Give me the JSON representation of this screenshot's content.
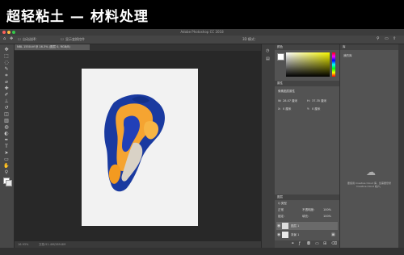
{
  "banner": {
    "title": "超轻粘土 — 材料处理"
  },
  "window": {
    "title": "Adobe Photoshop CC 2018"
  },
  "options_bar": {
    "auto_select_label": "自动选择：",
    "transform_label": "显示变换控件",
    "mode_label": "3D 模式："
  },
  "document": {
    "tab_label": "NBL 1550.tif @ 16.3% (图层 0, RGB/8)",
    "zoom": "16.93%",
    "doc_size": "文档:51.4M/289.8M"
  },
  "tools": [
    {
      "icon": "move-tool-icon",
      "glyph": "✥"
    },
    {
      "icon": "marquee-tool-icon",
      "glyph": "⬚"
    },
    {
      "icon": "lasso-tool-icon",
      "glyph": "◌"
    },
    {
      "icon": "quick-select-tool-icon",
      "glyph": "✎"
    },
    {
      "icon": "crop-tool-icon",
      "glyph": "⌗"
    },
    {
      "icon": "eyedropper-tool-icon",
      "glyph": "⌀"
    },
    {
      "icon": "healing-brush-tool-icon",
      "glyph": "✚"
    },
    {
      "icon": "brush-tool-icon",
      "glyph": "✐"
    },
    {
      "icon": "clone-stamp-tool-icon",
      "glyph": "⊥"
    },
    {
      "icon": "history-brush-tool-icon",
      "glyph": "↺"
    },
    {
      "icon": "eraser-tool-icon",
      "glyph": "◫"
    },
    {
      "icon": "gradient-tool-icon",
      "glyph": "▥"
    },
    {
      "icon": "blur-tool-icon",
      "glyph": "◍"
    },
    {
      "icon": "dodge-tool-icon",
      "glyph": "◐"
    },
    {
      "icon": "pen-tool-icon",
      "glyph": "✒"
    },
    {
      "icon": "type-tool-icon",
      "glyph": "T"
    },
    {
      "icon": "path-select-tool-icon",
      "glyph": "➤"
    },
    {
      "icon": "shape-tool-icon",
      "glyph": "▭"
    },
    {
      "icon": "hand-tool-icon",
      "glyph": "✋"
    },
    {
      "icon": "zoom-tool-icon",
      "glyph": "⚲"
    }
  ],
  "panels": {
    "color_tab": "颜色",
    "properties_tab": "属性",
    "properties_subtitle": "像素图层属性",
    "prop_w_label": "W:",
    "prop_w_value": "28.07 厘米",
    "prop_h_label": "H:",
    "prop_h_value": "37.35 厘米",
    "prop_x_label": "X:",
    "prop_x_value": "0 厘米",
    "prop_y_label": "Y:",
    "prop_y_value": "0 厘米",
    "layers_tab": "图层",
    "kind_label": "Q 类型",
    "blend_mode": "正常",
    "opacity_label": "不透明度：",
    "opacity_value": "100%",
    "lock_label": "锁定：",
    "fill_label": "填充：",
    "fill_value": "100%",
    "layers": [
      {
        "name": "图层 1",
        "selected": true
      },
      {
        "name": "背景 1",
        "selected": false
      }
    ],
    "libraries_tab": "库",
    "library_name": "我的库",
    "library_hint": "要使用 Creative Cloud 库，您需要登录 Creative Cloud 帐户。"
  },
  "colors": {
    "app_bg": "#323232",
    "panel_bg": "#535353",
    "canvas_bg": "#282828",
    "artboard": "#f2f2f2",
    "clay_blue": "#1a3aa0",
    "clay_orange": "#f5a431"
  }
}
